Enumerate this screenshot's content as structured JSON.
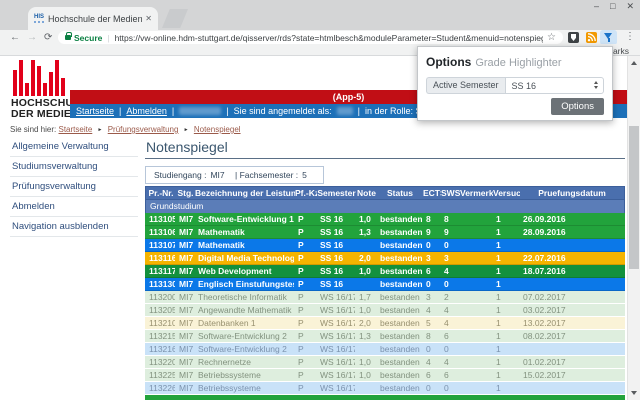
{
  "browser": {
    "tab_title": "Hochschule der Medien",
    "favicon_text": "HIS",
    "url": "https://vw-online.hdm-stuttgart.de/qisserver/rds?state=htmlbesch&moduleParameter=Student&menuid=notenspiegel&breadcrumb=notens...",
    "secure_label": "Secure",
    "bookmarks_fragment": "marks"
  },
  "icons": {
    "minimize": "–",
    "maximize": "□",
    "close": "✕",
    "back": "←",
    "forward": "→",
    "reload": "⟳",
    "star": "☆",
    "menu": "⋮",
    "tab_close": "✕",
    "breadcrumb_arrow": "►",
    "pipe": "|"
  },
  "extension_popup": {
    "title": "Options",
    "subtitle": "Grade Highlighter",
    "field_label": "Active Semester",
    "field_value": "SS 16",
    "button_label": "Options"
  },
  "page": {
    "logo": {
      "line1": "HOCHSCHULE",
      "line2": "DER MEDIEN"
    },
    "app_badge": "(App-5)",
    "nav": {
      "startseite": "Startseite",
      "abmelden": "Abmelden",
      "logged_in_label": "Sie sind angemeldet als:",
      "role_label": "in der Rolle: Student"
    },
    "breadcrumb": {
      "prefix": "Sie sind hier:",
      "links": [
        "Startseite",
        "Prüfungsverwaltung",
        "Notenspiegel"
      ]
    },
    "sidebar": {
      "items": [
        "Allgemeine Verwaltung",
        "Studiumsverwaltung",
        "Prüfungsverwaltung",
        "Abmelden",
        "Navigation ausblenden"
      ]
    },
    "content": {
      "title": "Notenspiegel",
      "filter": {
        "studiengang_label": "Studiengang :",
        "studiengang_value": "MI7",
        "fachsemester_label": "| Fachsemester :",
        "fachsemester_value": "5"
      },
      "table": {
        "columns": [
          "Pr.-Nr.",
          "Stg.",
          "Bezeichnung der Leistung",
          "Pf.-Kz.",
          "Semester",
          "Note",
          "Status",
          "ECTS",
          "SWS",
          "Vermerk",
          "Versuch",
          "Pruefungsdatum"
        ],
        "section": "Grundstudium",
        "rows": [
          {
            "style": "green",
            "cells": [
              "113105",
              "MI7",
              "Software-Entwicklung 1",
              "P",
              "SS 16",
              "1,0",
              "bestanden",
              "8",
              "8",
              "",
              "1",
              "26.09.2016"
            ]
          },
          {
            "style": "green",
            "cells": [
              "113106",
              "MI7",
              "Mathematik",
              "P",
              "SS 16",
              "1,3",
              "bestanden",
              "9",
              "9",
              "",
              "1",
              "28.09.2016"
            ]
          },
          {
            "style": "blue",
            "cells": [
              "113107",
              "MI7",
              "Mathematik",
              "P",
              "SS 16",
              "",
              "bestanden",
              "0",
              "0",
              "",
              "1",
              ""
            ]
          },
          {
            "style": "amber",
            "cells": [
              "113116",
              "MI7",
              "Digital Media Technologie",
              "P",
              "SS 16",
              "2,0",
              "bestanden",
              "3",
              "3",
              "",
              "1",
              "22.07.2016"
            ]
          },
          {
            "style": "green-dark",
            "cells": [
              "113117",
              "MI7",
              "Web Development",
              "P",
              "SS 16",
              "1,0",
              "bestanden",
              "6",
              "4",
              "",
              "1",
              "18.07.2016"
            ]
          },
          {
            "style": "blue",
            "cells": [
              "113130",
              "MI7",
              "Englisch Einstufungstest",
              "P",
              "SS 16",
              "",
              "bestanden",
              "0",
              "0",
              "",
              "1",
              ""
            ]
          },
          {
            "style": "light-green",
            "cells": [
              "113200",
              "MI7",
              "Theoretische Informatik",
              "P",
              "WS 16/17",
              "1,7",
              "bestanden",
              "3",
              "2",
              "",
              "1",
              "07.02.2017"
            ]
          },
          {
            "style": "light-green",
            "cells": [
              "113205",
              "MI7",
              "Angewandte Mathematik",
              "P",
              "WS 16/17",
              "1,0",
              "bestanden",
              "4",
              "4",
              "",
              "1",
              "03.02.2017"
            ]
          },
          {
            "style": "light-cream",
            "cells": [
              "113210",
              "MI7",
              "Datenbanken 1",
              "P",
              "WS 16/17",
              "2,0",
              "bestanden",
              "5",
              "4",
              "",
              "1",
              "13.02.2017"
            ]
          },
          {
            "style": "light-green",
            "cells": [
              "113215",
              "MI7",
              "Software-Entwicklung 2",
              "P",
              "WS 16/17",
              "1,3",
              "bestanden",
              "8",
              "6",
              "",
              "1",
              "08.02.2017"
            ]
          },
          {
            "style": "light-blue",
            "cells": [
              "113216",
              "MI7",
              "Software-Entwicklung 2",
              "P",
              "WS 16/17",
              "",
              "bestanden",
              "0",
              "0",
              "",
              "1",
              ""
            ]
          },
          {
            "style": "light-green",
            "cells": [
              "113220",
              "MI7",
              "Rechnernetze",
              "P",
              "WS 16/17",
              "1,0",
              "bestanden",
              "4",
              "4",
              "",
              "1",
              "01.02.2017"
            ]
          },
          {
            "style": "light-green",
            "cells": [
              "113225",
              "MI7",
              "Betriebssysteme",
              "P",
              "WS 16/17",
              "1,0",
              "bestanden",
              "6",
              "6",
              "",
              "1",
              "15.02.2017"
            ]
          },
          {
            "style": "light-blue",
            "cells": [
              "113226",
              "MI7",
              "Betriebssysteme",
              "P",
              "WS 16/17",
              "",
              "bestanden",
              "0",
              "0",
              "",
              "1",
              ""
            ]
          }
        ]
      }
    }
  },
  "colors": {
    "passed_green": "#22a33c",
    "passed_green_dark": "#13913d",
    "ungraded_blue": "#0b78e8",
    "highlight_amber": "#f5b400",
    "header_blue": "#4a6fae",
    "hdm_red": "#c10e15",
    "nav_blue": "#1d70b8",
    "logo_red": "#e2001a",
    "secure_green": "#0b8043"
  }
}
